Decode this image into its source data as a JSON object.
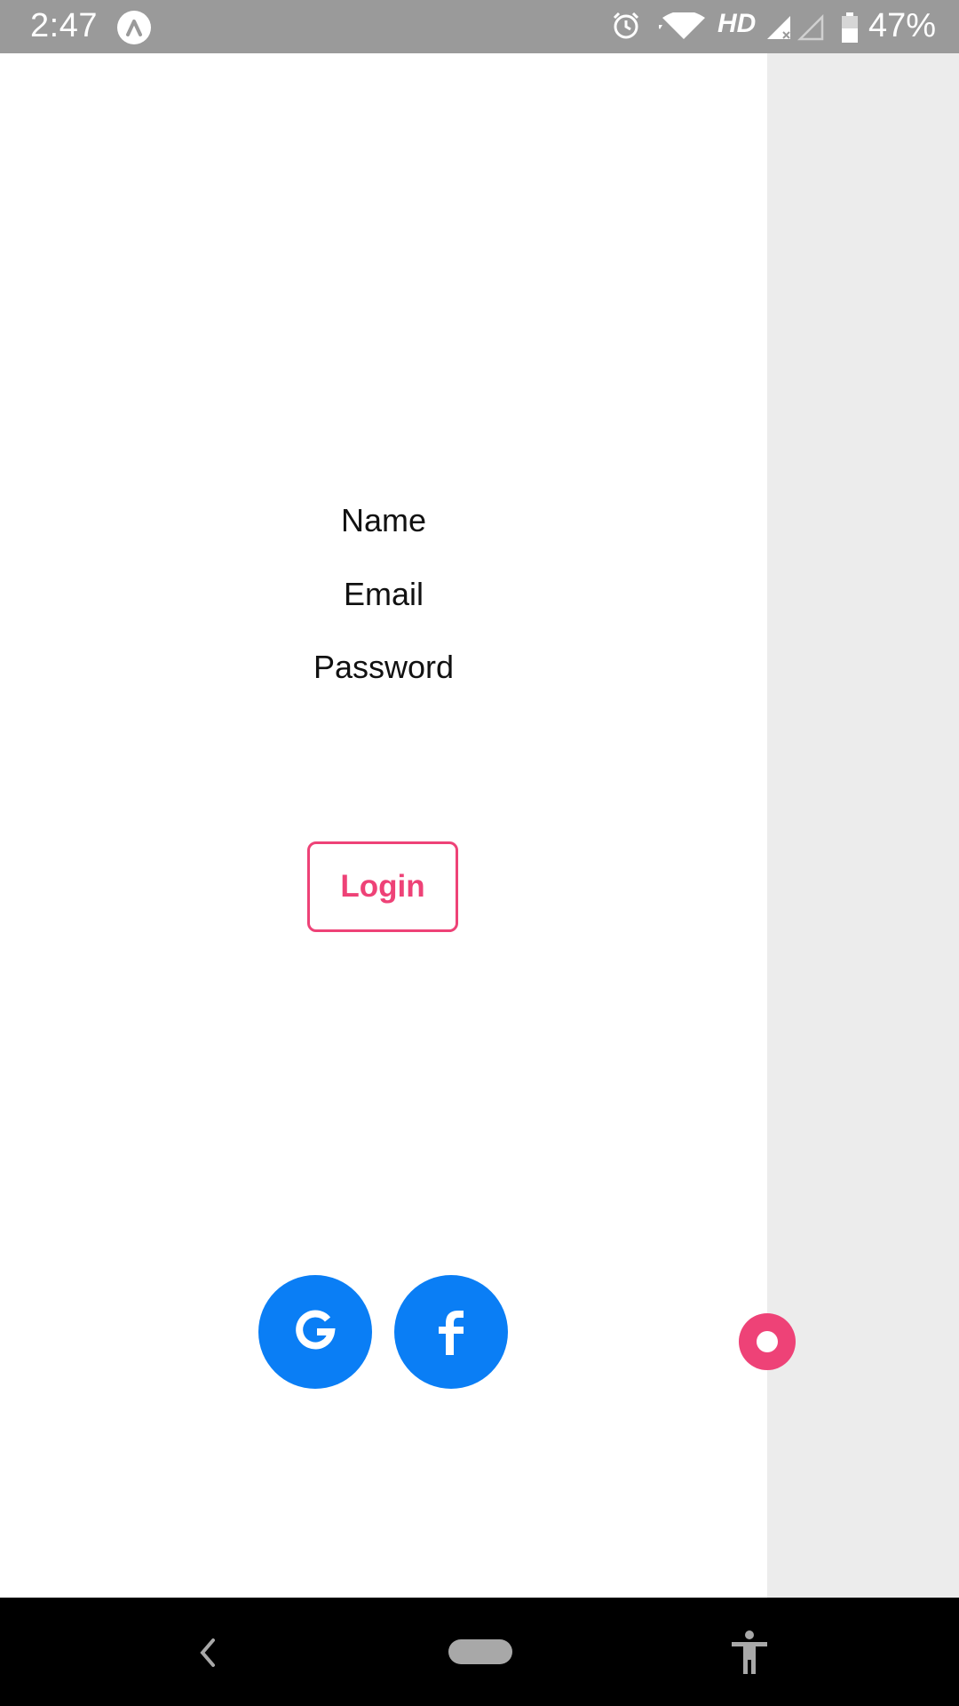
{
  "status_bar": {
    "time": "2:47",
    "hd": "HD",
    "battery": "47%",
    "icons": [
      "app-notification-icon",
      "alarm-icon",
      "wifi-icon",
      "signal-icon",
      "signal-empty-icon",
      "battery-icon"
    ]
  },
  "form": {
    "name_label": "Name",
    "email_label": "Email",
    "password_label": "Password",
    "login_label": "Login"
  },
  "social": {
    "google_letter": "G",
    "facebook_letter": "f"
  },
  "colors": {
    "accent": "#ee4277",
    "social_blue": "#0a7ef5",
    "status_bar": "#9a9a9a",
    "side_panel": "#ececec"
  }
}
